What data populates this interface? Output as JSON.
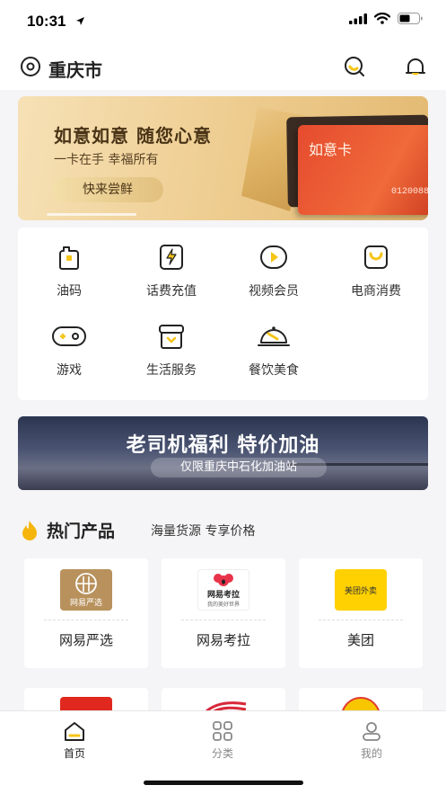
{
  "status_bar": {
    "time": "10:31",
    "icons": [
      "location-arrow-icon",
      "signal-icon",
      "wifi-icon",
      "battery-icon"
    ]
  },
  "header": {
    "city": "重庆市",
    "icons": [
      "location-icon",
      "search-icon",
      "bell-icon"
    ]
  },
  "banner_card": {
    "title": "如意如意  随您心意",
    "subtitle": "一卡在手  幸福所有",
    "button": "快来尝鲜",
    "card_name": "如意卡",
    "card_number": "01200888"
  },
  "services": [
    {
      "label": "油码",
      "icon": "fuel-icon"
    },
    {
      "label": "话费充值",
      "icon": "phone-recharge-icon"
    },
    {
      "label": "视频会员",
      "icon": "video-icon"
    },
    {
      "label": "电商消费",
      "icon": "shopping-bag-icon"
    },
    {
      "label": "游戏",
      "icon": "gamepad-icon"
    },
    {
      "label": "生活服务",
      "icon": "life-service-icon"
    },
    {
      "label": "餐饮美食",
      "icon": "food-cloche-icon"
    }
  ],
  "promo_banner": {
    "title": "老司机福利  特价加油",
    "subtitle": "仅限重庆中石化加油站"
  },
  "hot_section": {
    "title": "热门产品",
    "subtitle": "海量货源  专享价格"
  },
  "products": [
    {
      "name": "网易严选",
      "logo_text": "网易严选"
    },
    {
      "name": "网易考拉",
      "logo_text": "网易考拉",
      "logo_subtext": "我的美好世界"
    },
    {
      "name": "美团",
      "logo_text": "美团外卖"
    }
  ],
  "tabs": [
    {
      "label": "首页",
      "icon": "home-icon",
      "active": true
    },
    {
      "label": "分类",
      "icon": "category-icon",
      "active": false
    },
    {
      "label": "我的",
      "icon": "profile-icon",
      "active": false
    }
  ],
  "colors": {
    "accent": "#f5c518",
    "text": "#222222",
    "background": "#f5f5f7"
  }
}
